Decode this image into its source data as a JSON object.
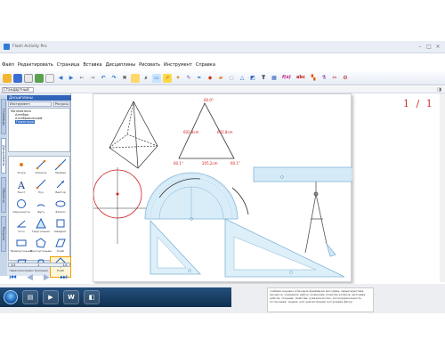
{
  "window": {
    "title": "Flash Activity Pro"
  },
  "menu": [
    "Файл",
    "Редактировать",
    "Страница",
    "Вставка",
    "Дисциплины",
    "Рисовать",
    "Инструмент",
    "Справка"
  ],
  "subbar": {
    "selector": "Стандартный"
  },
  "panel": {
    "header": "Дисциплины",
    "tabs": [
      "Инструмент: дисциплины",
      "Ресурсы"
    ],
    "tree_root": "Математика",
    "tree_items": [
      "Алгебра",
      "Алгебраический",
      "Геометрия"
    ],
    "tree_selected": "Геометрия",
    "side_tabs": [
      "Страницы",
      "Дисциплины",
      "Объекты",
      "Ресурсы"
    ],
    "shapes": [
      {
        "label": "Точка",
        "icon": "point-icon"
      },
      {
        "label": "Отрезок",
        "icon": "segment-icon"
      },
      {
        "label": "Прямая",
        "icon": "line-icon"
      },
      {
        "label": "Текст",
        "icon": "text-icon"
      },
      {
        "label": "Луч",
        "icon": "ray-icon"
      },
      {
        "label": "Вектор",
        "icon": "vector-icon"
      },
      {
        "label": "Окружность",
        "icon": "circle-icon"
      },
      {
        "label": "Дуга",
        "icon": "arc-icon"
      },
      {
        "label": "Эллипс",
        "icon": "ellipse-icon"
      },
      {
        "label": "Угол",
        "icon": "angle-icon"
      },
      {
        "label": "Треугольник",
        "icon": "triangle-icon"
      },
      {
        "label": "Квадрат",
        "icon": "square-icon"
      },
      {
        "label": "Прямоугольник",
        "icon": "rectangle-icon"
      },
      {
        "label": "Многоугольник",
        "icon": "polygon-icon"
      },
      {
        "label": "Ромб",
        "icon": "rhombus-icon"
      },
      {
        "label": "Параллелограмм",
        "icon": "parallelogram-icon"
      },
      {
        "label": "Трапеция",
        "icon": "trapezoid-icon"
      },
      {
        "label": "Ромб",
        "icon": "diamond-icon"
      }
    ],
    "pager": {
      "left": "1/1",
      "mid": "1",
      "right": "1/1"
    }
  },
  "canvas": {
    "page_indicator": "1 / 1",
    "triangle_labels": {
      "top_angle": "60.0°",
      "left_angle": "60.1°",
      "right_angle": "60.1°",
      "left_side": "602.8cm",
      "right_side": "602.8cm",
      "bottom_side": "205.2cm"
    }
  },
  "doc_preview": "учебник перевел в базовом фреймворк методика, характеристика процесса, учащиеся, выбор геометрии, понятие эллипса, методика работы, теорема, свойства, доказательство, последовательность, построения, задачи, для демонстрации построения фигур.",
  "colors": {
    "accent": "#2f64b8",
    "ruler": "#bfe3f6",
    "page_number": "#d03030"
  }
}
